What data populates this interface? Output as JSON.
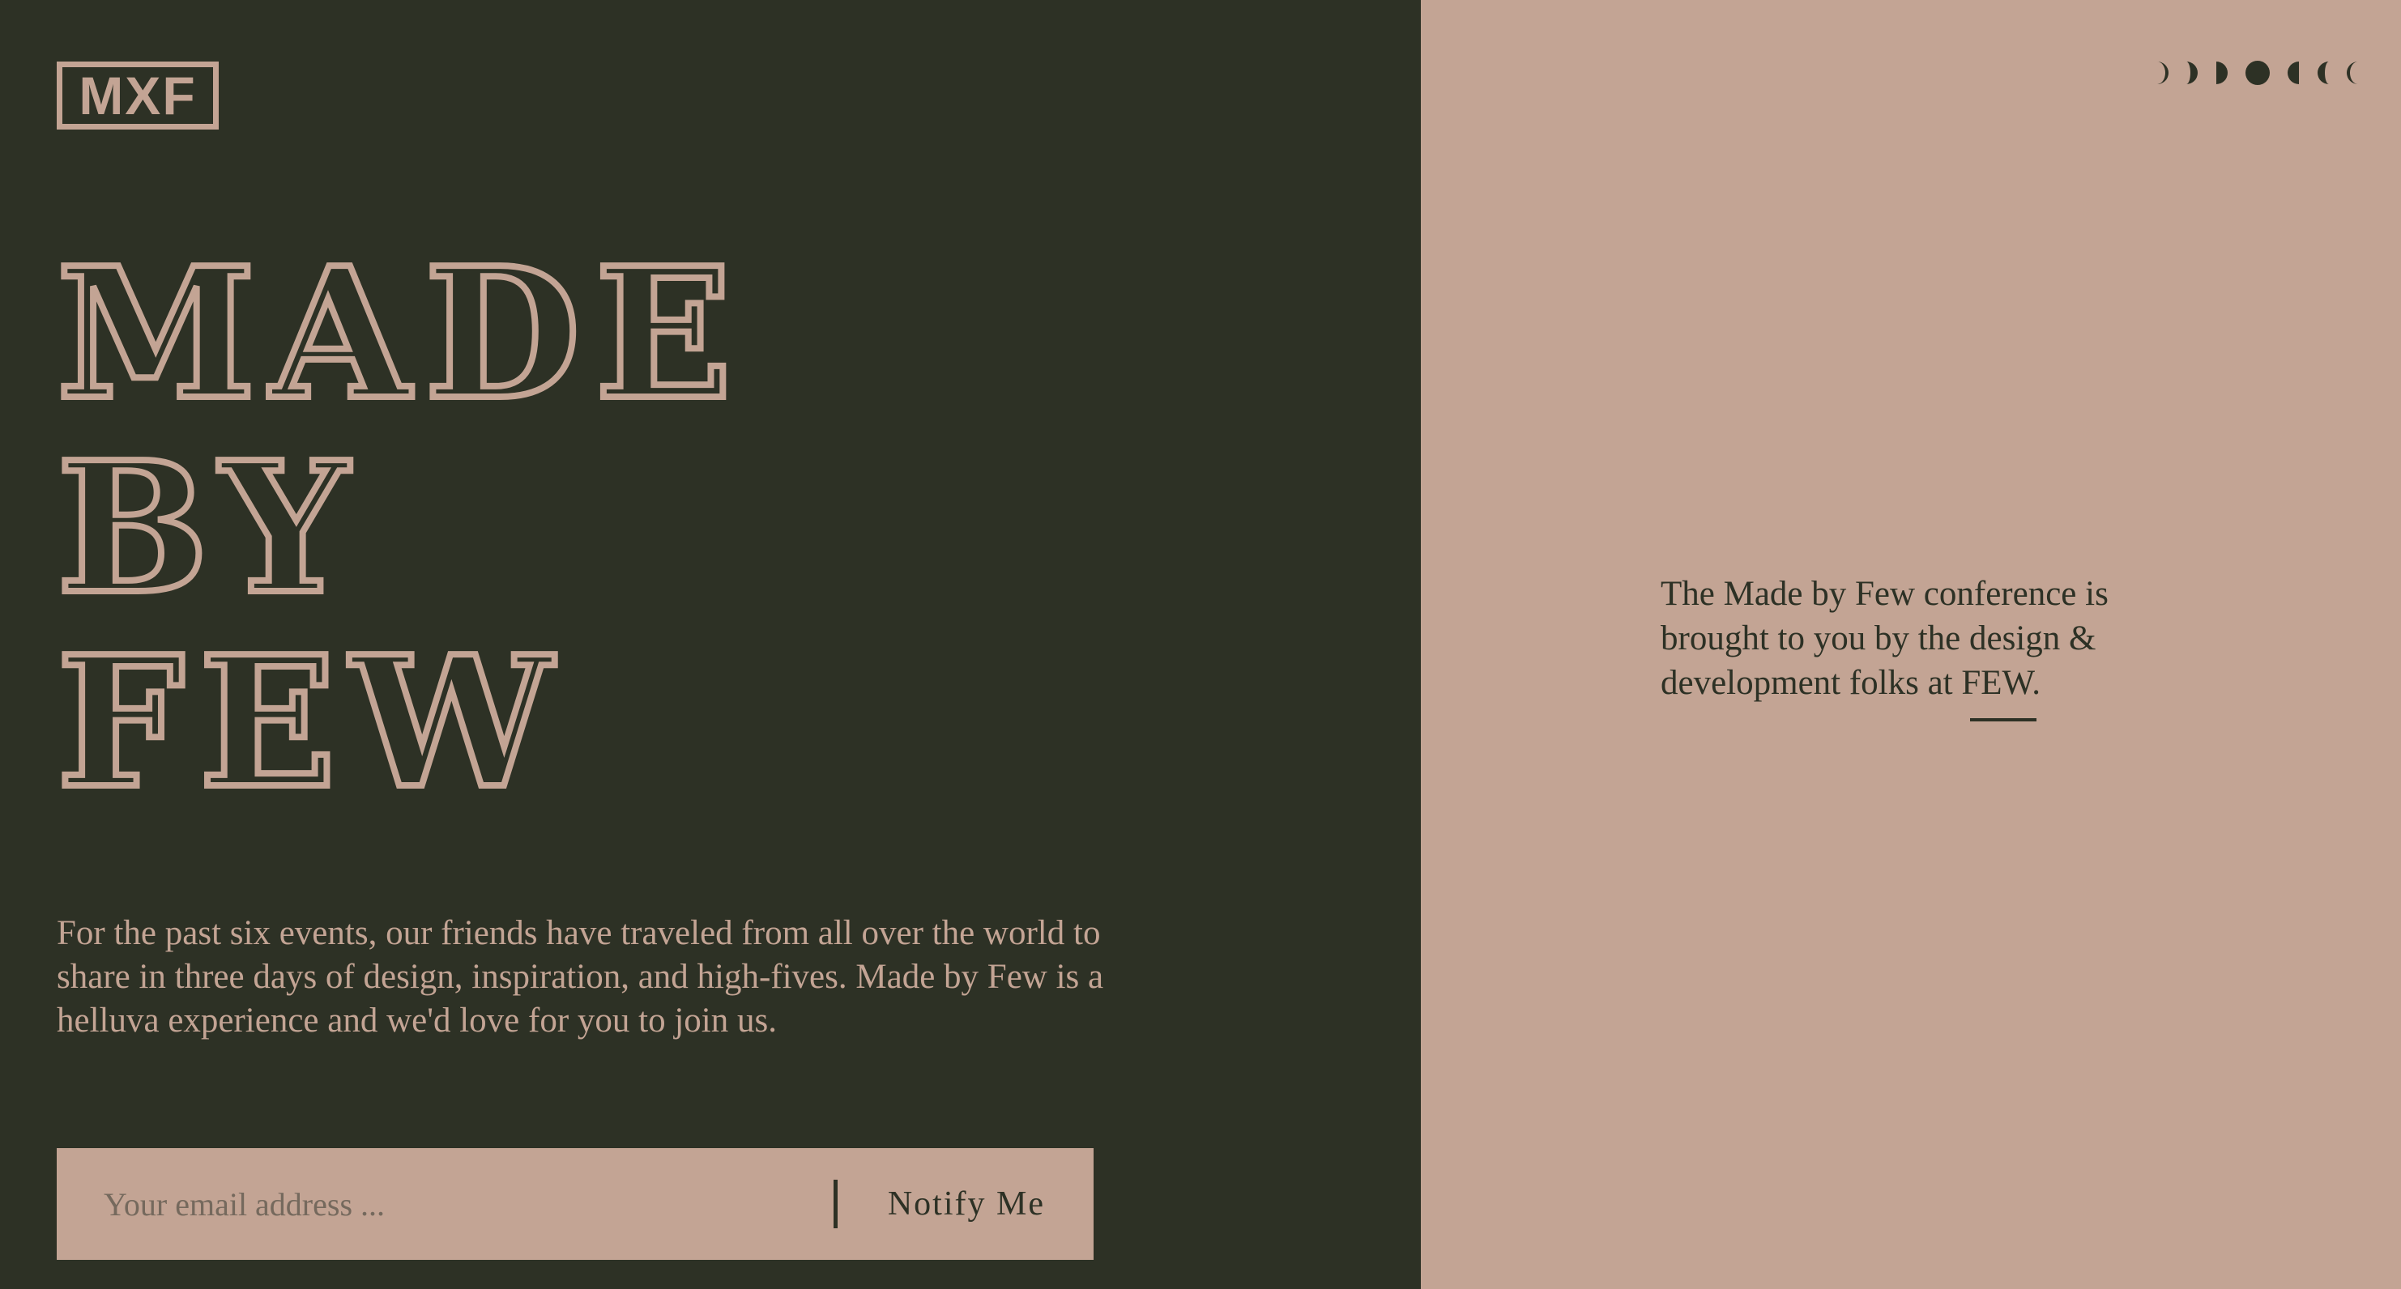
{
  "brand": {
    "logo_text": "MXF"
  },
  "headline": {
    "lines": [
      "Made",
      "By",
      "Few"
    ]
  },
  "intro": {
    "text": "For the past six events, our friends have traveled from all over the world to share in three days of design, inspiration, and high-fives. Made by Few is a helluva experience and we'd love for you to  join us."
  },
  "signup": {
    "email_placeholder": "Your email address ...",
    "email_value": "",
    "button_label": "Notify Me"
  },
  "nav": {
    "moon_phases": [
      "waxing-crescent-icon",
      "waxing-half-icon",
      "waxing-gibbous-icon",
      "full-moon-icon",
      "waning-gibbous-icon",
      "waning-half-icon",
      "waning-crescent-icon"
    ]
  },
  "about": {
    "text": "The Made by Few conference is brought to you by the design & development folks at FEW."
  },
  "colors": {
    "dark_green": "#2d3125",
    "dusty_rose": "#c3a494"
  }
}
